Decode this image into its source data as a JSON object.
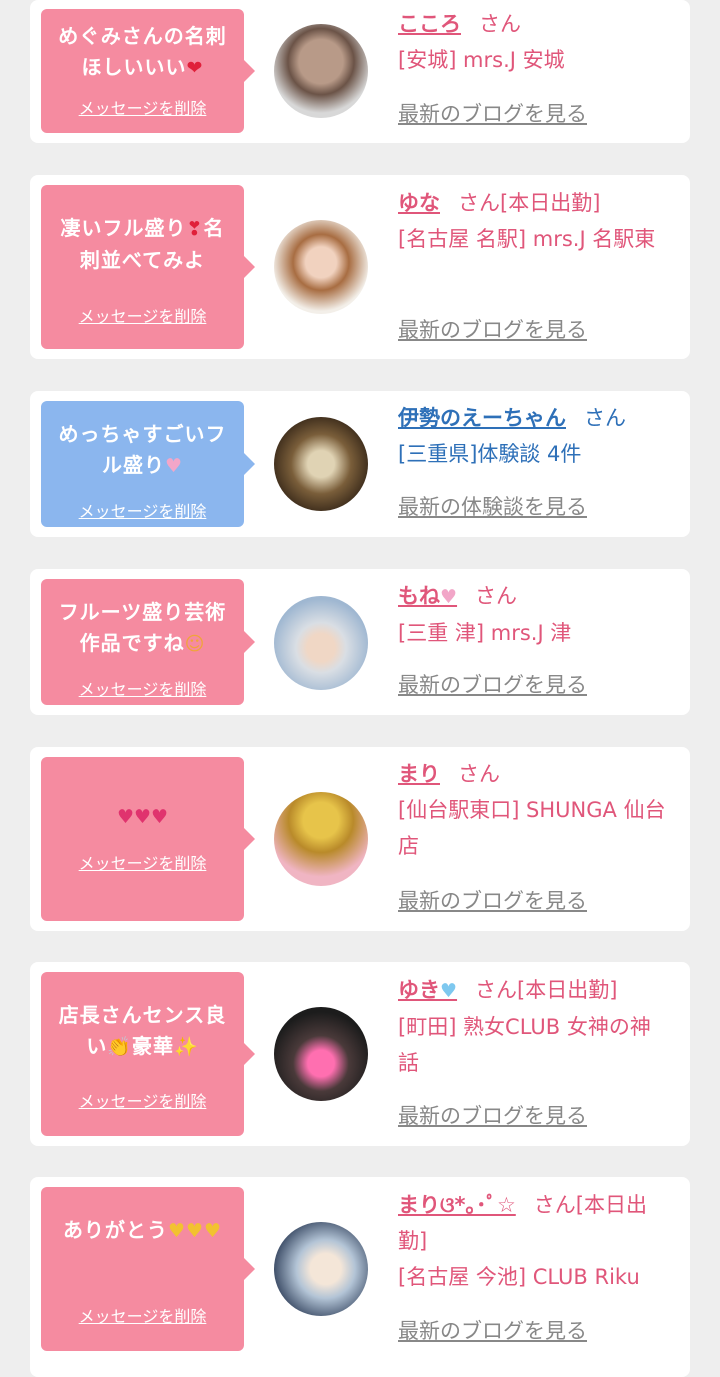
{
  "suffix_san": "さん",
  "delete_label": "メッセージを削除",
  "colors": {
    "pink_bubble": "#f58ba0",
    "blue_bubble": "#8bb6ee",
    "name_pink": "#e0567a",
    "name_blue": "#2e70b8",
    "link_gray": "#888888"
  },
  "cards": [
    {
      "message": "めぐみさんの名刺ほしいいい",
      "emoji": "❤",
      "name": "こころ",
      "name_suffix": "さん",
      "shop": "[安城] mrs.J 安城",
      "link": "最新のブログを見る"
    },
    {
      "message": "凄いフル盛り",
      "emoji": "❣",
      "message2": "名刺並べてみよ",
      "name": "ゆな",
      "name_suffix": "さん[本日出勤]",
      "shop": "[名古屋 名駅] mrs.J 名駅東",
      "link": "最新のブログを見る"
    },
    {
      "message": "めっちゃすごいフル盛り",
      "emoji": "♥",
      "name": "伊勢のえーちゃん",
      "name_suffix": "さん",
      "shop": "[三重県]体験談 4件",
      "link": "最新の体験談を見る"
    },
    {
      "message": "フルーツ盛り芸術作品ですね",
      "emoji": "☺",
      "name": "もね",
      "name_emoji": "♥",
      "name_suffix": "さん",
      "shop": "[三重 津] mrs.J 津",
      "link": "最新のブログを見る"
    },
    {
      "message": "",
      "emoji": "♥♥♥",
      "name": "まり",
      "name_suffix": "さん",
      "shop": "[仙台駅東口] SHUNGA 仙台店",
      "link": "最新のブログを見る"
    },
    {
      "message": "店長さんセンス良い",
      "emoji": "👏",
      "message2": "豪華",
      "emoji2": "✨",
      "name": "ゆき",
      "name_emoji": "♥",
      "name_suffix": "さん[本日出勤]",
      "shop": "[町田] 熟女CLUB 女神の神話",
      "link": "最新のブログを見る"
    },
    {
      "message": "ありがとう",
      "emoji": "♥♥♥",
      "name": "まりଓ*｡･ﾟ☆",
      "name_suffix": "さん[本日出勤]",
      "shop": "[名古屋 今池] CLUB Riku",
      "link": "最新のブログを見る"
    }
  ]
}
